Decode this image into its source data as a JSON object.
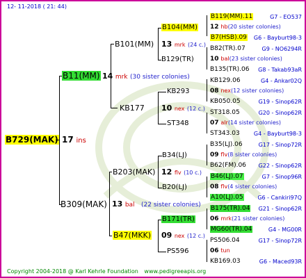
{
  "header": {
    "date": "12- 11-2018 ( 21: 44)"
  },
  "footer": {
    "copyright": "Copyright 2004-2018 @ Karl Kehrle Foundation",
    "site": "www.pedigreeapis.org"
  },
  "root": {
    "id": "B729(MAK)",
    "count": "17",
    "mark": "ins"
  },
  "gen2": [
    {
      "id": "B11(MM)",
      "count": "14",
      "mark": "mrk",
      "sisters": "(30 sister colonies)"
    },
    {
      "id": "B309(MAK)",
      "count": "13",
      "mark": "bal",
      "sisters": "(22 sister colonies)"
    }
  ],
  "gen3": [
    {
      "id": "B101(MM)",
      "count": "13",
      "mark": "mrk",
      "sisters": "(24 c.)"
    },
    {
      "id": "KB177",
      "count": "10",
      "mark": "nex",
      "sisters": "(12 c.)"
    },
    {
      "id": "B203(MAK)",
      "count": "12",
      "mark": "flv",
      "sisters": "(10 c.)"
    },
    {
      "id": "B47(MKK)",
      "count": "09",
      "mark": "nex",
      "sisters": "(12 c.)"
    }
  ],
  "gen4": [
    {
      "id": "B104(MM)",
      "count": "",
      "mark": "",
      "sisters": ""
    },
    {
      "id": "B129(TR)",
      "count": "",
      "mark": "",
      "sisters": ""
    },
    {
      "id": "KB293",
      "count": "",
      "mark": "",
      "sisters": ""
    },
    {
      "id": "ST348",
      "count": "",
      "mark": "",
      "sisters": ""
    },
    {
      "id": "B34(LJ)",
      "count": "",
      "mark": "",
      "sisters": ""
    },
    {
      "id": "B20(LJ)",
      "count": "",
      "mark": "",
      "sisters": ""
    },
    {
      "id": "B171(TR)",
      "count": "",
      "mark": "",
      "sisters": ""
    },
    {
      "id": "PS596",
      "count": "",
      "mark": "",
      "sisters": ""
    }
  ],
  "gen5": [
    {
      "id": "B119(MM).11",
      "count": "12",
      "mark": "hb",
      "sisters": "(20 sister colonies)",
      "loc": "G7 - EO537"
    },
    {
      "id": "B7(HSB).09",
      "loc": "G6 - Bayburt98-3"
    },
    {
      "id": "B82(TR).07",
      "count": "10",
      "mark": "bal",
      "sisters": "(23 sister colonies)",
      "loc": "G9 - NO6294R"
    },
    {
      "id": "B135(TR).06",
      "loc": "G8 - Takab93aR"
    },
    {
      "id": "KB129.06",
      "count": "08",
      "mark": "nex",
      "sisters": "(12 sister colonies)",
      "loc": "G4 - Ankar02Q"
    },
    {
      "id": "KB050.05",
      "loc": "G19 - Sinop62R"
    },
    {
      "id": "ST318.05",
      "count": "07",
      "mark": "alr",
      "sisters": "(14 sister colonies)",
      "loc": "G20 - Sinop62R"
    },
    {
      "id": "ST343.03",
      "loc": "G4 - Bayburt98-3"
    },
    {
      "id": "B35(LJ).06",
      "count": "09",
      "mark": "flv",
      "sisters": "(8 sister colonies)",
      "loc": "G17 - Sinop72R"
    },
    {
      "id": "B62(FM).06",
      "loc": "G22 - Sinop62R"
    },
    {
      "id": "B46(LJ).07",
      "count": "08",
      "mark": "flv",
      "sisters": "(4 sister colonies)",
      "loc": "G7 - Sinop96R"
    },
    {
      "id": "A10(LJ).05",
      "loc": "G6 - Cankiri97Q"
    },
    {
      "id": "B175(TR).04",
      "count": "06",
      "mark": "mrk",
      "sisters": "(21 sister colonies)",
      "loc": "G21 - Sinop62R"
    },
    {
      "id": "MG60(TR).04",
      "loc": "G4 - MG00R"
    },
    {
      "id": "PS506.04",
      "count": "06",
      "mark": "tun",
      "sisters": "",
      "loc": "G17 - Sinop72R"
    },
    {
      "id": "KB169.03",
      "loc": "G6 - Maced93R"
    }
  ]
}
